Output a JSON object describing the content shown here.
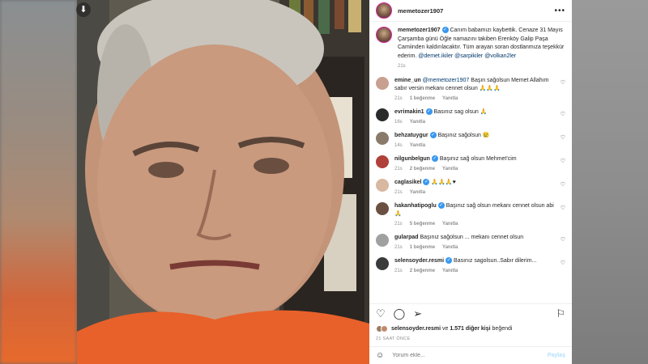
{
  "post": {
    "username": "memetozer1907",
    "caption_text": "Canım babamızı kaybettik. Cenaze 31 Mayıs Çarşamba günü Öğle namazını takiben Erenköy Galip Paşa Camiinden kaldırılacaktır. Tüm arayan soran dostlanmıza teşekkür ederim.",
    "caption_mentions": "@demet.ikiler @sarpikiler @volkan2ler",
    "caption_time": "21s",
    "likes_prefix": "selensoyder.resmi",
    "likes_mid": " ve ",
    "likes_count": "1.571 diğer kişi",
    "likes_suffix": " beğendi",
    "date": "21 SAAT ÖNCE",
    "comment_placeholder": "Yorum ekle...",
    "post_button": "Paylaş"
  },
  "comments": [
    {
      "user": "emine_un",
      "mention": "@memetozer1907",
      "text": " Başın sağolsun Memet Allahım sabır versin mekanı cennet olsun 🙏🙏🙏",
      "time": "21s",
      "likes": "1 beğenme",
      "reply": "Yanıtla"
    },
    {
      "user": "evrimakin1",
      "text": "Basınız sag olsun 🙏",
      "time": "16s",
      "reply": "Yanıtla"
    },
    {
      "user": "behzatuygur",
      "text": "Başınız sağolsun 😢",
      "time": "14s",
      "reply": "Yanıtla"
    },
    {
      "user": "nilgunbelgun",
      "text": "Başınız sağ olsun Mehmet'cim",
      "time": "21s",
      "likes": "2 beğenme",
      "reply": "Yanıtla"
    },
    {
      "user": "caglasikel",
      "text": "🙏🙏🙏♥",
      "time": "21s",
      "reply": "Yanıtla"
    },
    {
      "user": "hakanhatipoglu",
      "text": "Başınız sağ olsun mekanı cennet olsun abi 🙏",
      "time": "21s",
      "likes": "5 beğenme",
      "reply": "Yanıtla"
    },
    {
      "user": "gularpad",
      "text": "Başınız sağolsun ... mekanı cennet olsun",
      "time": "21s",
      "likes": "1 beğenme",
      "reply": "Yanıtla"
    },
    {
      "user": "selensoyder.resmi",
      "text": "Basınız sagolsun..Sabır dilerim...",
      "time": "21s",
      "likes": "2 beğenme",
      "reply": "Yanıtla"
    }
  ],
  "icons": {
    "download": "download-icon",
    "more": "more-options-icon",
    "heart": "heart-icon",
    "comment": "comment-icon",
    "share": "share-icon",
    "save": "bookmark-icon",
    "emoji": "emoji-icon",
    "verified": "verified-badge-icon"
  },
  "colors": {
    "verified": "#3897f0",
    "mention": "#00376b",
    "muted": "#8e8e8e",
    "shirt": "#e8612a"
  }
}
